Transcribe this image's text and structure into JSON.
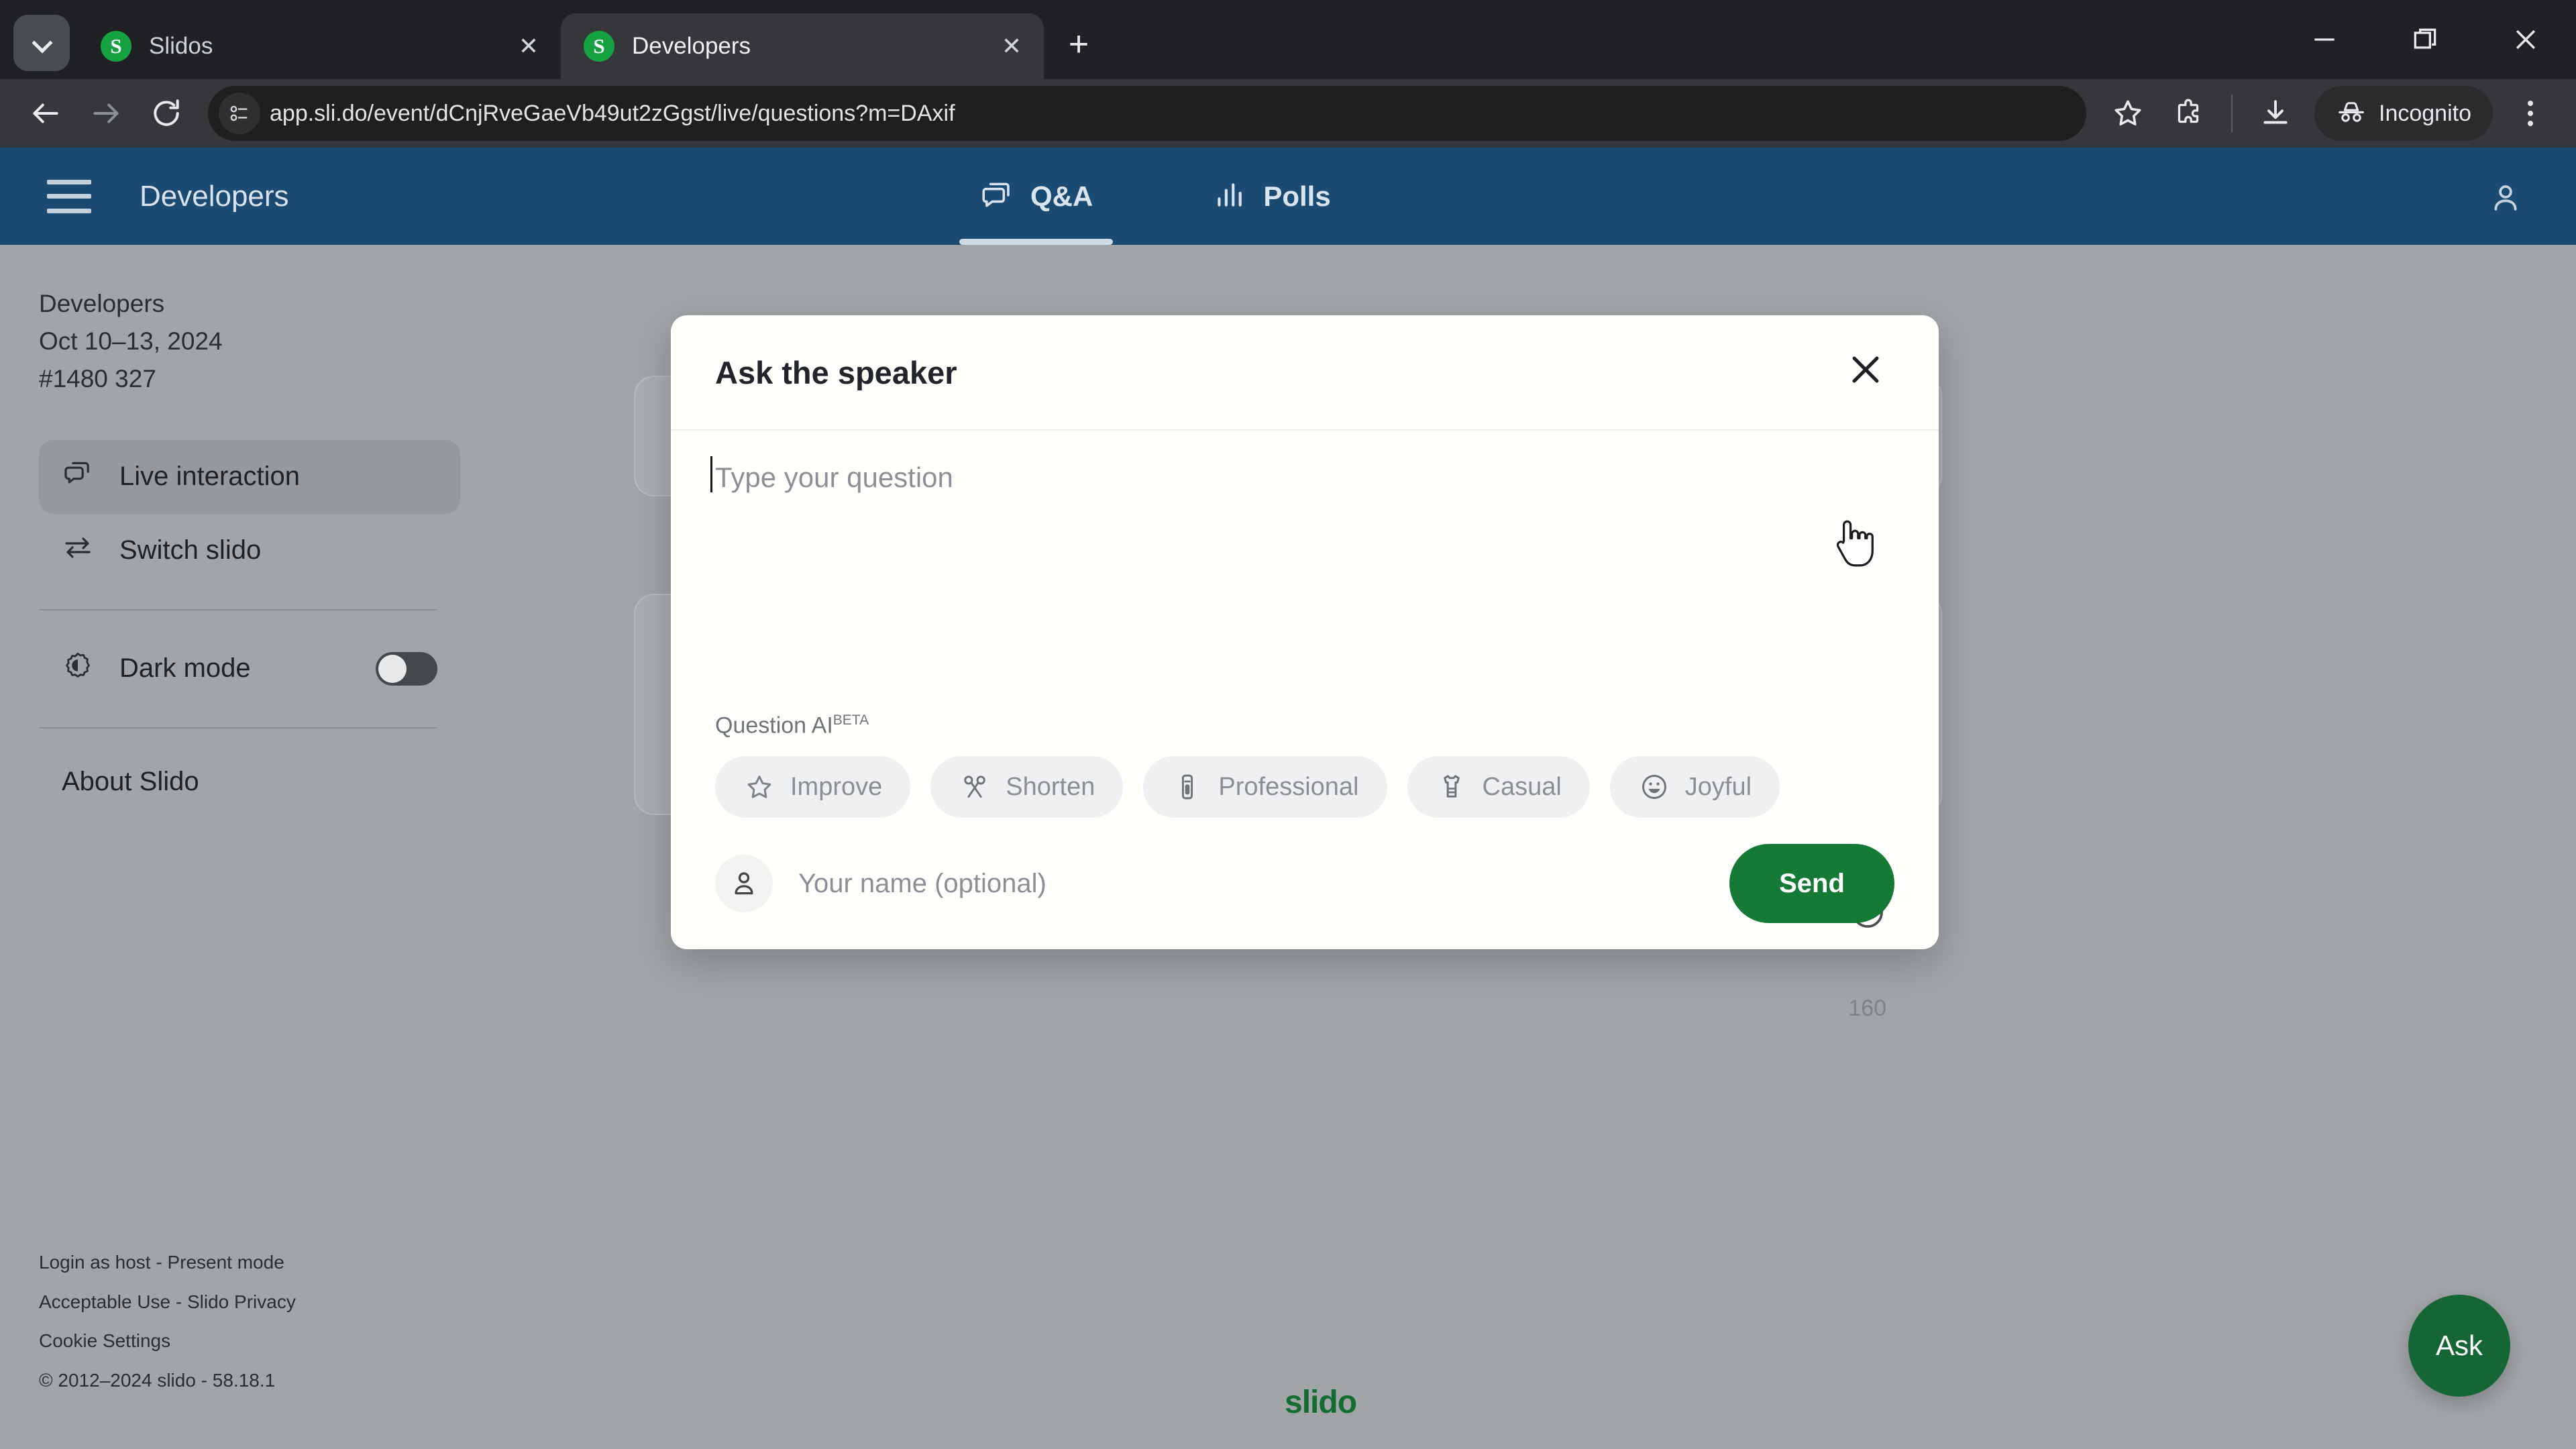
{
  "browser": {
    "tabs": [
      {
        "title": "Slidos",
        "favicon_letter": "S",
        "active": false
      },
      {
        "title": "Developers",
        "favicon_letter": "S",
        "active": true
      }
    ],
    "new_tab_label": "+",
    "tab_close_label": "✕",
    "tab_list_icon": "chevron-down-icon",
    "window_controls": {
      "minimize": "—",
      "maximize": "❐",
      "close": "✕"
    },
    "toolbar": {
      "back_icon": "back-arrow-icon",
      "forward_icon": "forward-arrow-icon",
      "reload_icon": "reload-icon",
      "site_info_icon": "site-settings-icon",
      "url": "app.sli.do/event/dCnjRveGaeVb49ut2zGgst/live/questions?m=DAxif",
      "bookmark_icon": "star-icon",
      "extensions_icon": "extensions-puzzle-icon",
      "downloads_icon": "download-icon",
      "incognito_label": "Incognito",
      "incognito_icon": "incognito-hat-icon",
      "menu_icon": "kebab-menu-icon"
    }
  },
  "app": {
    "header": {
      "menu_icon": "hamburger-menu-icon",
      "title": "Developers",
      "profile_icon": "user-profile-icon",
      "tabs": [
        {
          "label": "Q&A",
          "icon": "speech-bubble-icon",
          "active": true
        },
        {
          "label": "Polls",
          "icon": "bar-chart-icon",
          "active": false
        }
      ]
    },
    "sidebar": {
      "event_name": "Developers",
      "event_dates": "Oct 10–13, 2024",
      "event_code": "#1480 327",
      "items": [
        {
          "label": "Live interaction",
          "icon": "chat-bubbles-icon",
          "active": true
        },
        {
          "label": "Switch slido",
          "icon": "switch-arrows-icon",
          "active": false
        }
      ],
      "dark_mode": {
        "label": "Dark mode",
        "icon": "brightness-icon",
        "enabled": false
      },
      "about_label": "About Slido",
      "footer": [
        "Login as host - Present mode",
        "Acceptable Use - Slido Privacy",
        "Cookie Settings",
        "© 2012–2024 slido - 58.18.1"
      ]
    },
    "brand_logo": "slido",
    "ask_fab_label": "Ask"
  },
  "modal": {
    "title": "Ask the speaker",
    "close_icon": "close-icon",
    "question_placeholder": "Type your question",
    "question_value": "",
    "emoji_icon": "emoji-smiley-icon",
    "char_counter": "160",
    "question_ai": {
      "label": "Question AI",
      "badge": "BETA",
      "chips": [
        {
          "label": "Improve",
          "icon": "star-outline-icon"
        },
        {
          "label": "Shorten",
          "icon": "scissors-icon"
        },
        {
          "label": "Professional",
          "icon": "necktie-icon"
        },
        {
          "label": "Casual",
          "icon": "tshirt-icon"
        },
        {
          "label": "Joyful",
          "icon": "grinning-face-icon"
        }
      ]
    },
    "name_placeholder": "Your name (optional)",
    "name_value": "",
    "name_icon": "person-icon",
    "send_label": "Send"
  },
  "colors": {
    "app_header": "#1b4a73",
    "brand_green": "#157a35",
    "page_bg": "#a2a5a8",
    "modal_bg": "#fffffb"
  }
}
